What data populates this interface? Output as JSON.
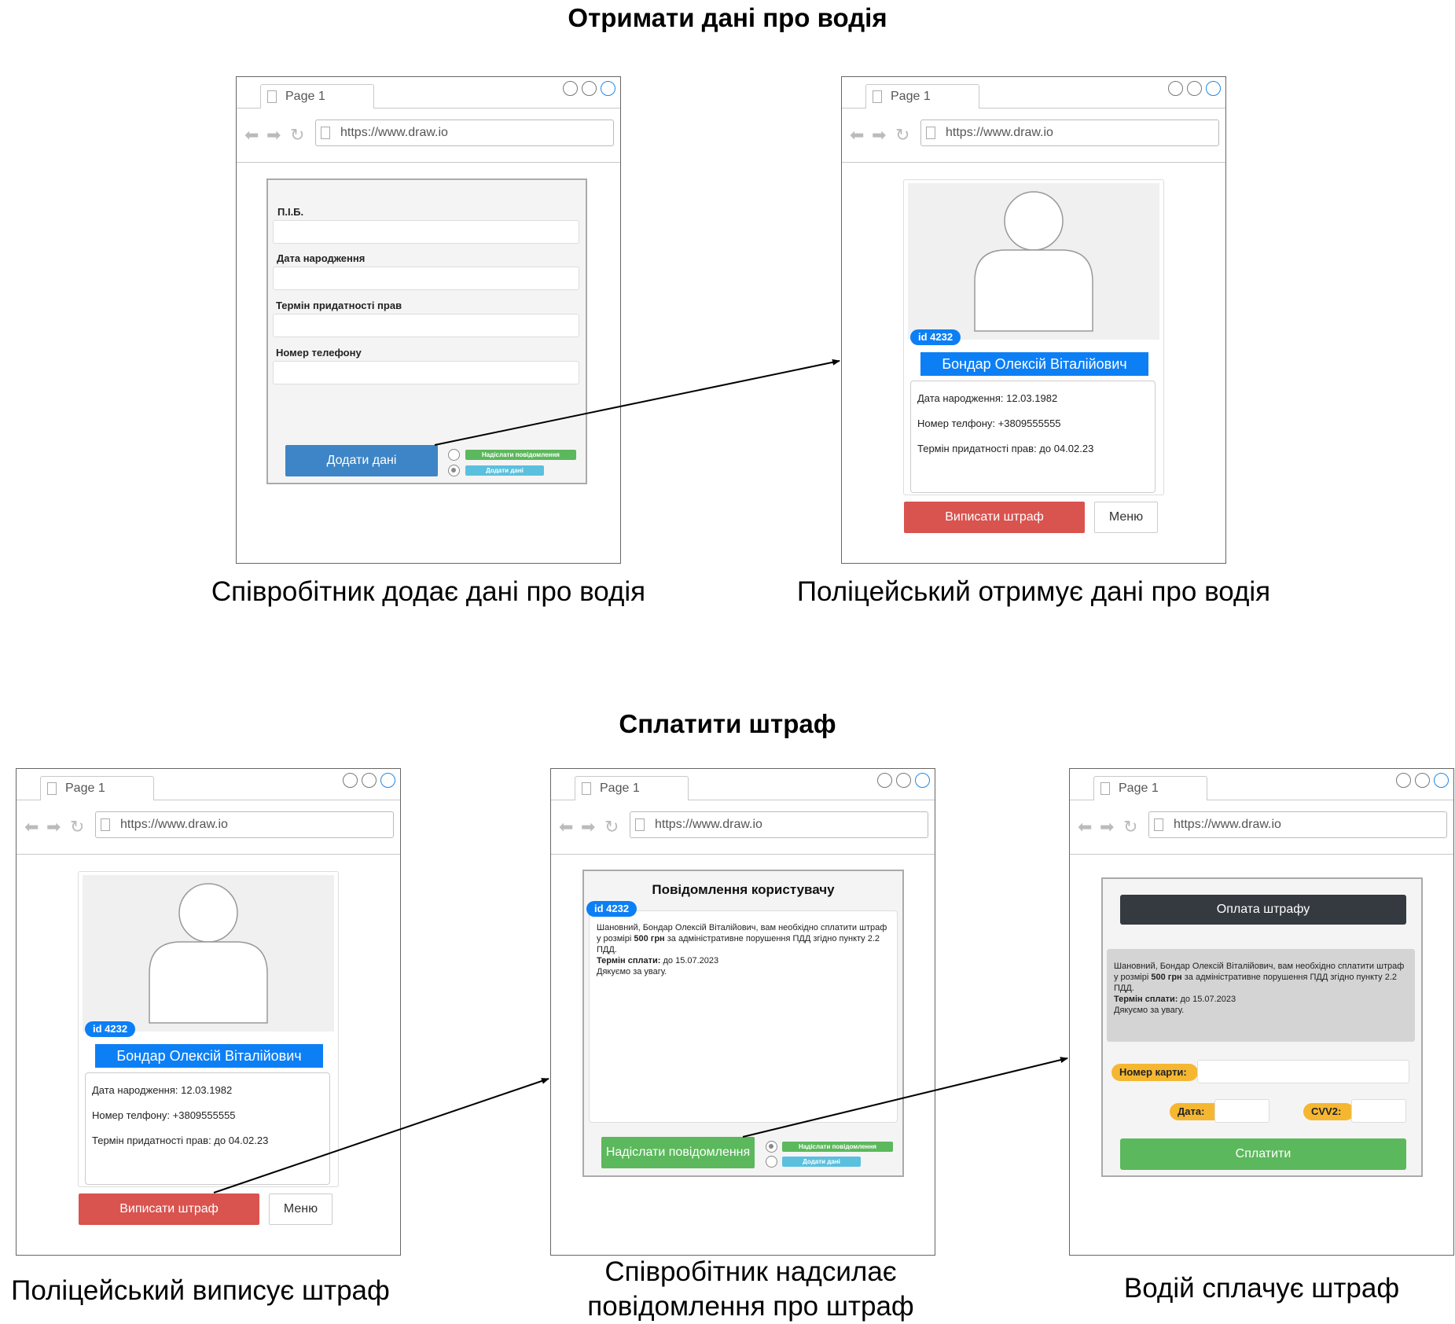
{
  "section1": {
    "title": "Отримати дані про водія"
  },
  "section2": {
    "title": "Сплатити штраф"
  },
  "browser": {
    "tab_label": "Page 1",
    "url": "https://www.draw.io"
  },
  "form": {
    "fields": [
      {
        "label": "П.І.Б."
      },
      {
        "label": "Дата народження"
      },
      {
        "label": "Термін придатності прав"
      },
      {
        "label": "Номер телефону"
      }
    ],
    "submit_label": "Додати дані"
  },
  "radio_options": {
    "send_message": "Надіслати повідомлення",
    "add_data": "Додати дані"
  },
  "profile": {
    "id_badge": "id 4232",
    "name": "Бондар Олексій Віталійович",
    "birth_date": "Дата народження: 12.03.1982",
    "phone_line_1": "Номер телфону: +3809555555",
    "phone_line_2": "Номер телфону: +3809555555",
    "license_term": "Термін придатності прав: до 04.02.23",
    "fine_button": "Виписати штраф",
    "menu_button": "Меню"
  },
  "message": {
    "title": "Повідомлення користувачу",
    "text_part1": "Шановний, Бондар Олексій Віталійович, вам необхідно сплатити штраф у розмірі ",
    "amount": "500 грн",
    "text_part2": " за адміністративне порушення ПДД згідно пункту 2.2 ПДД.",
    "deadline_label": "Термін сплати:",
    "deadline_value": " до 15.07.2023",
    "thanks": "Дякуємо за увагу.",
    "send_button": "Надіслати повідомлення"
  },
  "payment": {
    "header": "Оплата штрафу",
    "card_number_label": "Номер карти:",
    "date_label": "Дата:",
    "cvv_label": "CVV2:",
    "pay_button": "Сплатити"
  },
  "captions": {
    "employee_adds": "Співробітник додає дані про водія",
    "police_receives": "Поліцейський отримує дані про водія",
    "police_fines": "Поліцейський виписує штраф",
    "employee_sends_line1": "Співробітник надсилає",
    "employee_sends_line2": "повідомлення про штраф",
    "driver_pays": "Водій сплачує штраф"
  },
  "colors": {
    "primary_blue": "#0d7ff5",
    "button_blue": "#3d85c6",
    "danger_red": "#d9534f",
    "success_green": "#5cb85c",
    "dark": "#343a40",
    "badge_yellow": "#f5b731"
  }
}
